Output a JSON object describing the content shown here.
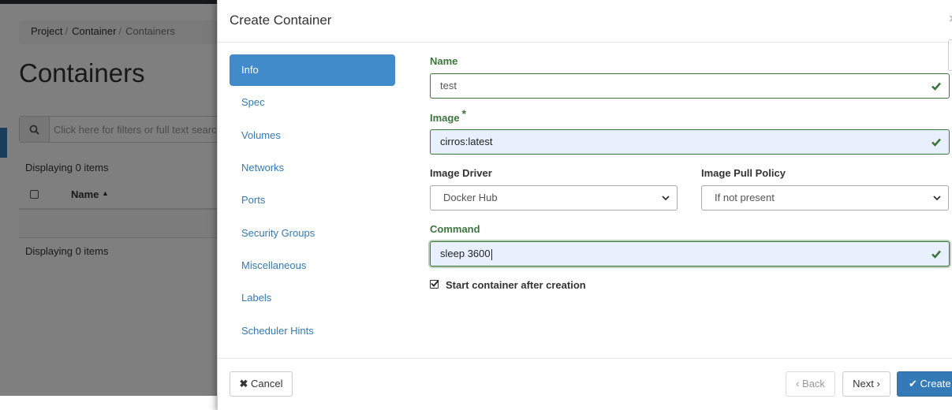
{
  "background": {
    "breadcrumb": [
      "Project",
      "Container",
      "Containers"
    ],
    "breadcrumb_sep": "/",
    "page_title": "Containers",
    "filter_placeholder": "Click here for filters or full text search",
    "displaying_top": "Displaying 0 items",
    "displaying_bottom": "Displaying 0 items",
    "table_headers": [
      "Name"
    ]
  },
  "modal": {
    "title": "Create Container",
    "close_symbol": "×",
    "nav": [
      {
        "label": "Info",
        "active": true
      },
      {
        "label": "Spec",
        "active": false
      },
      {
        "label": "Volumes",
        "active": false
      },
      {
        "label": "Networks",
        "active": false
      },
      {
        "label": "Ports",
        "active": false
      },
      {
        "label": "Security Groups",
        "active": false
      },
      {
        "label": "Miscellaneous",
        "active": false
      },
      {
        "label": "Labels",
        "active": false
      },
      {
        "label": "Scheduler Hints",
        "active": false
      }
    ],
    "form": {
      "name_label": "Name",
      "name_value": "test",
      "image_label": "Image",
      "required_mark": "*",
      "image_value": "cirros:latest",
      "image_driver_label": "Image Driver",
      "image_driver_value": "Docker Hub",
      "image_pull_policy_label": "Image Pull Policy",
      "image_pull_policy_value": "If not present",
      "command_label": "Command",
      "command_value": "sleep 3600",
      "start_after_creation_label": "Start container after creation",
      "start_after_creation_checked": true
    },
    "footer": {
      "cancel_label": "Cancel",
      "back_label": "Back",
      "next_label": "Next",
      "create_label": "Create"
    }
  },
  "colors": {
    "success": "#3c763d",
    "accent": "#428bca",
    "primary_button": "#337ab7",
    "link": "#337ab7"
  }
}
